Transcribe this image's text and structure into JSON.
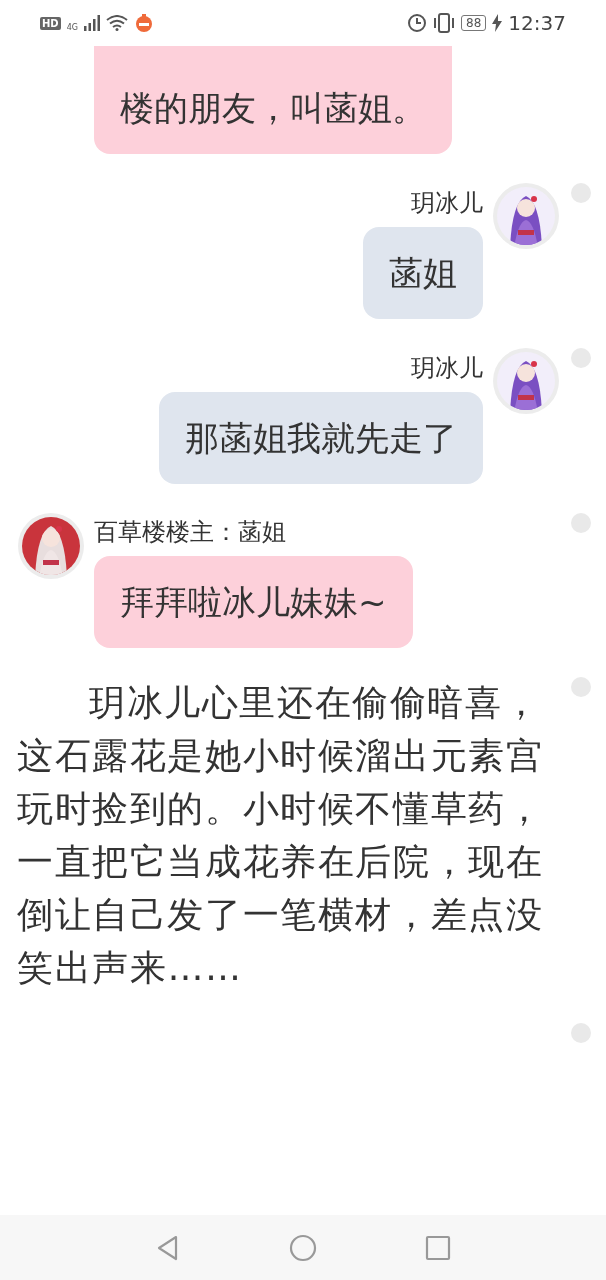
{
  "status_bar": {
    "hd": "HD",
    "network": "4G",
    "battery": "88",
    "time": "12:37"
  },
  "messages": [
    {
      "kind": "received",
      "text": "楼的朋友，叫菡姐。"
    },
    {
      "kind": "sent",
      "sender": "玥冰儿",
      "text": "菡姐",
      "selected": false
    },
    {
      "kind": "sent",
      "sender": "玥冰儿",
      "text": "那菡姐我就先走了",
      "selected": false
    },
    {
      "kind": "received",
      "sender": "百草楼楼主：菡姐",
      "text": "拜拜啦冰儿妹妹~",
      "selected": false
    },
    {
      "kind": "narration",
      "text": "玥冰儿心里还在偷偷暗喜，这石露花是她小时候溜出元素宫玩时捡到的。小时候不懂草药，一直把它当成花养在后院，现在倒让自己发了一笔横材，差点没笑出声来……",
      "selected": false
    },
    {
      "kind": "blank",
      "selected": false
    }
  ]
}
